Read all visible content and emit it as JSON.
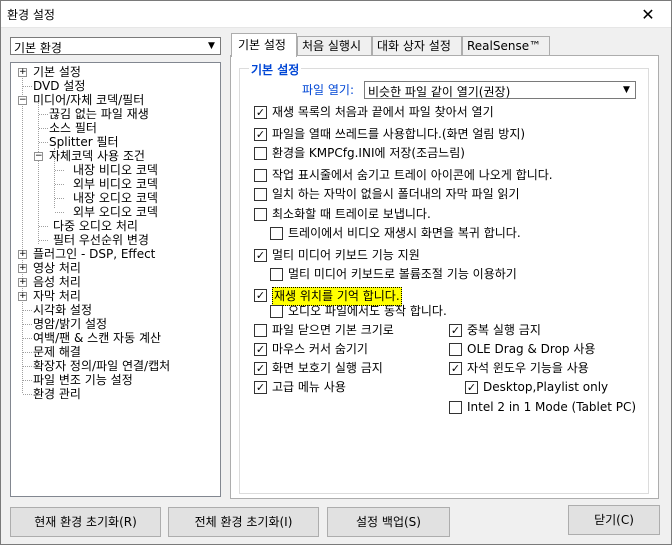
{
  "window": {
    "title": "환경 설정",
    "close_glyph": "✕"
  },
  "category_select": {
    "value": "기본 환경"
  },
  "tree": {
    "items": [
      {
        "label": "기본 설정",
        "toggle": "+"
      },
      {
        "label": "DVD 설정"
      },
      {
        "label": "미디어/자체 코덱/필터",
        "toggle": "−"
      },
      {
        "label": "끊김 없는 파일 재생"
      },
      {
        "label": "소스 필터"
      },
      {
        "label": "Splitter 필터"
      },
      {
        "label": "자체코덱 사용 조건",
        "toggle": "−"
      },
      {
        "label": "내장 비디오 코덱"
      },
      {
        "label": "외부 비디오 코덱"
      },
      {
        "label": "내장 오디오 코덱"
      },
      {
        "label": "외부 오디오 코덱"
      },
      {
        "label": "다중 오디오 처리"
      },
      {
        "label": "필터 우선순위 변경"
      },
      {
        "label": "플러그인 - DSP, Effect",
        "toggle": "+"
      },
      {
        "label": "영상 처리",
        "toggle": "+"
      },
      {
        "label": "음성 처리",
        "toggle": "+"
      },
      {
        "label": "자막 처리",
        "toggle": "+"
      },
      {
        "label": "시각화 설정"
      },
      {
        "label": "명암/밝기 설정"
      },
      {
        "label": "여백/팬 & 스캔 자동 계산"
      },
      {
        "label": "문제 해결"
      },
      {
        "label": "확장자 정의/파일 연결/캡처"
      },
      {
        "label": "파일 변조 기능 설정"
      },
      {
        "label": "환경 관리"
      }
    ]
  },
  "tabs": [
    {
      "label": "기본 설정"
    },
    {
      "label": "처음 실행시"
    },
    {
      "label": "대화 상자 설정"
    },
    {
      "label": "RealSense™"
    }
  ],
  "panel": {
    "group_title": "기본 설정",
    "file_open_label": "파일 열기:",
    "file_open_value": "비슷한 파일 같이 열기(권장)",
    "options": [
      {
        "label": "재생 목록의 처음과 끝에서 파일 찾아서 열기",
        "checked": true
      },
      {
        "label": "파일을 열때 쓰레드를 사용합니다.(화면 얼림 방지)",
        "checked": true
      },
      {
        "label": "환경을 KMPCfg.INI에 저장(조금느림)",
        "checked": false
      },
      {
        "label": "작업 표시줄에서 숨기고 트레이 아이콘에 나오게 합니다.",
        "checked": false
      },
      {
        "label": "일치 하는 자막이 없을시 폴더내의 자막 파일 읽기",
        "checked": false
      },
      {
        "label": "최소화할 때 트레이로 보냅니다.",
        "checked": false
      },
      {
        "label": "트레이에서 비디오 재생시 화면을 복귀 합니다.",
        "checked": false
      },
      {
        "label": "멀티 미디어 키보드 기능 지원",
        "checked": true
      },
      {
        "label": "멀티 미디어 키보드로 볼륨조절 기능 이용하기",
        "checked": false
      },
      {
        "label": "재생 위치를 기억 합니다.",
        "checked": true
      },
      {
        "label": "오디오 파일에서도 동작 합니다.",
        "checked": false
      },
      {
        "label": "파일 닫으면 기본 크기로",
        "checked": false
      },
      {
        "label": "마우스 커서 숨기기",
        "checked": true
      },
      {
        "label": "화면 보호기 실행 금지",
        "checked": true
      },
      {
        "label": "고급 메뉴 사용",
        "checked": true
      },
      {
        "label": "중복 실행 금지",
        "checked": true
      },
      {
        "label": "OLE Drag & Drop 사용",
        "checked": false
      },
      {
        "label": "자석 윈도우 기능을 사용",
        "checked": true
      },
      {
        "label": "Desktop,Playlist only",
        "checked": true
      },
      {
        "label": "Intel 2 in 1 Mode (Tablet PC)",
        "checked": false
      }
    ]
  },
  "buttons": {
    "reset_current": "현재 환경 초기화(R)",
    "reset_all": "전체 환경 초기화(I)",
    "backup": "설정 백업(S)",
    "close": "닫기(C)"
  },
  "colors": {
    "group_title": "#0046d5",
    "highlight": "#ffff00"
  }
}
